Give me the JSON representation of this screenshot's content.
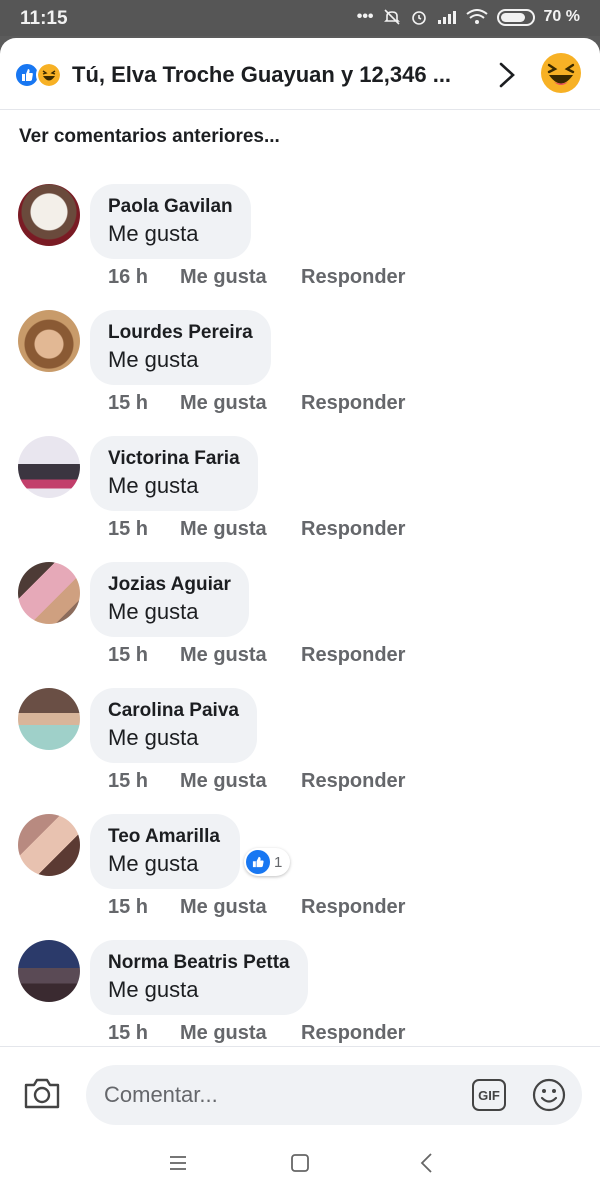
{
  "status": {
    "time": "11:15",
    "battery": "70 %"
  },
  "header": {
    "reactors": "Tú, Elva Troche Guayuan y 12,346 ..."
  },
  "earlier_label": "Ver comentarios anteriores...",
  "comments": [
    {
      "name": "Paola Gavilan",
      "text": "Me gusta",
      "time": "16 h",
      "like": "Me gusta",
      "reply": "Responder"
    },
    {
      "name": "Lourdes Pereira",
      "text": "Me gusta",
      "time": "15 h",
      "like": "Me gusta",
      "reply": "Responder"
    },
    {
      "name": "Victorina Faria",
      "text": "Me gusta",
      "time": "15 h",
      "like": "Me gusta",
      "reply": "Responder"
    },
    {
      "name": "Jozias Aguiar",
      "text": "Me gusta",
      "time": "15 h",
      "like": "Me gusta",
      "reply": "Responder"
    },
    {
      "name": "Carolina Paiva",
      "text": "Me gusta",
      "time": "15 h",
      "like": "Me gusta",
      "reply": "Responder"
    },
    {
      "name": "Teo Amarilla",
      "text": "Me gusta",
      "time": "15 h",
      "like": "Me gusta",
      "reply": "Responder",
      "like_count": "1"
    },
    {
      "name": "Norma Beatris Petta",
      "text": "Me gusta",
      "time": "15 h",
      "like": "Me gusta",
      "reply": "Responder"
    }
  ],
  "composer": {
    "placeholder": "Comentar...",
    "gif_label": "GIF"
  },
  "icons": {
    "header": [
      "like-reaction-icon",
      "haha-reaction-icon",
      "chevron-right-icon",
      "haha-reaction-icon"
    ],
    "composer": [
      "camera-icon",
      "gif-icon",
      "emoji-icon"
    ],
    "nav": [
      "menu-icon",
      "home-icon",
      "back-icon"
    ]
  },
  "colors": {
    "accent": "#1877f2",
    "bubble": "#f0f2f5",
    "meta": "#65676b",
    "haha": "#f7b125"
  }
}
